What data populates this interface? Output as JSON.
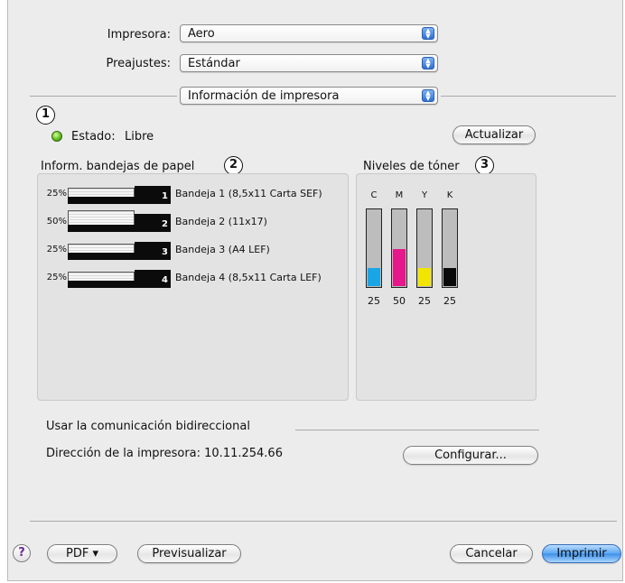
{
  "printer": {
    "label": "Impresora:",
    "value": "Aero"
  },
  "presets": {
    "label": "Preajustes:",
    "value": "Estándar"
  },
  "panel": {
    "value": "Información de impresora"
  },
  "status": {
    "label": "Estado:",
    "value": "Libre",
    "refresh": "Actualizar"
  },
  "callouts": [
    "1",
    "2",
    "3"
  ],
  "trays": {
    "title": "Inform. bandejas de papel",
    "items": [
      {
        "pct": "25%",
        "num": "1",
        "name": "Bandeja 1 (8,5x11 Carta SEF)",
        "level": 0.25
      },
      {
        "pct": "50%",
        "num": "2",
        "name": "Bandeja 2 (11x17)",
        "level": 0.5
      },
      {
        "pct": "25%",
        "num": "3",
        "name": "Bandeja 3 (A4 LEF)",
        "level": 0.25
      },
      {
        "pct": "25%",
        "num": "4",
        "name": "Bandeja 4 (8,5x11 Carta LEF)",
        "level": 0.25
      }
    ]
  },
  "toner": {
    "title": "Niveles de tóner",
    "items": [
      {
        "letter": "C",
        "value": "25",
        "level": 0.25,
        "color": "#1aa6e6"
      },
      {
        "letter": "M",
        "value": "50",
        "level": 0.5,
        "color": "#e6178a"
      },
      {
        "letter": "Y",
        "value": "25",
        "level": 0.25,
        "color": "#f2e600"
      },
      {
        "letter": "K",
        "value": "25",
        "level": 0.25,
        "color": "#0a0a0a"
      }
    ]
  },
  "bidirectional": {
    "label": "Usar la comunicación bidireccional",
    "address_label": "Dirección de la impresora: 10.11.254.66",
    "configure": "Configurar..."
  },
  "footer": {
    "help": "?",
    "pdf": "PDF ▾",
    "preview": "Previsualizar",
    "cancel": "Cancelar",
    "print": "Imprimir"
  }
}
